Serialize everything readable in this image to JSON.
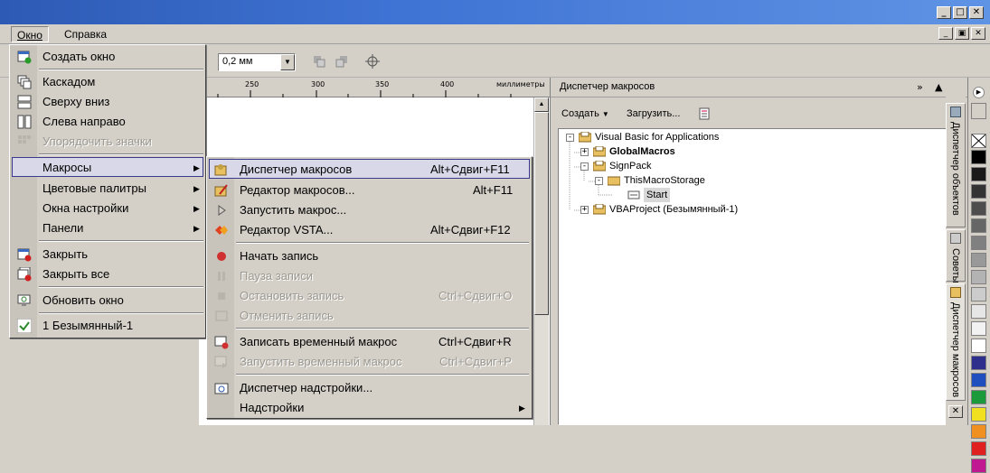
{
  "menubar": {
    "window": "Окно",
    "help": "Справка"
  },
  "toolbar": {
    "line_width": "0,2 мм"
  },
  "ruler": {
    "ticks": [
      "250",
      "300",
      "350",
      "400"
    ],
    "unit": "миллиметры"
  },
  "window_menu": {
    "items": [
      {
        "label": "Создать окно",
        "icon": "new-window-icon"
      },
      {
        "label": "Каскадом",
        "icon": "cascade-icon"
      },
      {
        "label": "Сверху вниз",
        "icon": "tile-horizontal-icon"
      },
      {
        "label": "Слева направо",
        "icon": "tile-vertical-icon"
      },
      {
        "label": "Упорядочить значки",
        "icon": "arrange-icons-icon",
        "disabled": true
      },
      {
        "label": "Макросы",
        "submenu": true,
        "highlighted": true
      },
      {
        "label": "Цветовые палитры",
        "submenu": true
      },
      {
        "label": "Окна настройки",
        "submenu": true
      },
      {
        "label": "Панели",
        "submenu": true
      },
      {
        "label": "Закрыть",
        "icon": "close-window-icon"
      },
      {
        "label": "Закрыть все",
        "icon": "close-all-icon"
      },
      {
        "label": "Обновить окно",
        "icon": "refresh-window-icon"
      },
      {
        "label": "1 Безымянный-1",
        "icon": "checkmark-icon"
      }
    ]
  },
  "macros_menu": {
    "items": [
      {
        "label": "Диспетчер макросов",
        "shortcut": "Alt+Сдвиг+F11"
      },
      {
        "label": "Редактор макросов...",
        "shortcut": "Alt+F11"
      },
      {
        "label": "Запустить макрос...",
        "shortcut": ""
      },
      {
        "label": "Редактор VSTA...",
        "shortcut": "Alt+Сдвиг+F12"
      },
      {
        "label": "Начать запись",
        "shortcut": ""
      },
      {
        "label": "Пауза записи",
        "shortcut": "",
        "disabled": true
      },
      {
        "label": "Остановить запись",
        "shortcut": "Ctrl+Сдвиг+O",
        "disabled": true
      },
      {
        "label": "Отменить запись",
        "shortcut": "",
        "disabled": true
      },
      {
        "label": "Записать временный макрос",
        "shortcut": "Ctrl+Сдвиг+R"
      },
      {
        "label": "Запустить временный макрос",
        "shortcut": "Ctrl+Сдвиг+P",
        "disabled": true
      },
      {
        "label": "Диспетчер надстройки...",
        "shortcut": ""
      },
      {
        "label": "Надстройки",
        "shortcut": "",
        "submenu": true
      }
    ]
  },
  "docker": {
    "title": "Диспетчер макросов",
    "create": "Создать",
    "load": "Загрузить...",
    "tree": {
      "root": "Visual Basic for Applications",
      "global": "GlobalMacros",
      "signpack": "SignPack",
      "storage": "ThisMacroStorage",
      "start": "Start",
      "vba": "VBAProject (Безымянный-1)"
    }
  },
  "side_tabs": {
    "objects": "Диспетчер объектов",
    "hints": "Советы",
    "macros": "Диспетчер макросов"
  },
  "palette": [
    "#ffffff",
    "#000000",
    "#1a1a1a",
    "#333333",
    "#4d4d4d",
    "#666666",
    "#808080",
    "#999999",
    "#b3b3b3",
    "#cccccc",
    "#e6e6e6",
    "#f2f2f2",
    "#ffffff",
    "#2e2e8c",
    "#1f4fbf",
    "#1a9a3a",
    "#f0e020",
    "#f09020",
    "#e02020",
    "#c01890"
  ]
}
